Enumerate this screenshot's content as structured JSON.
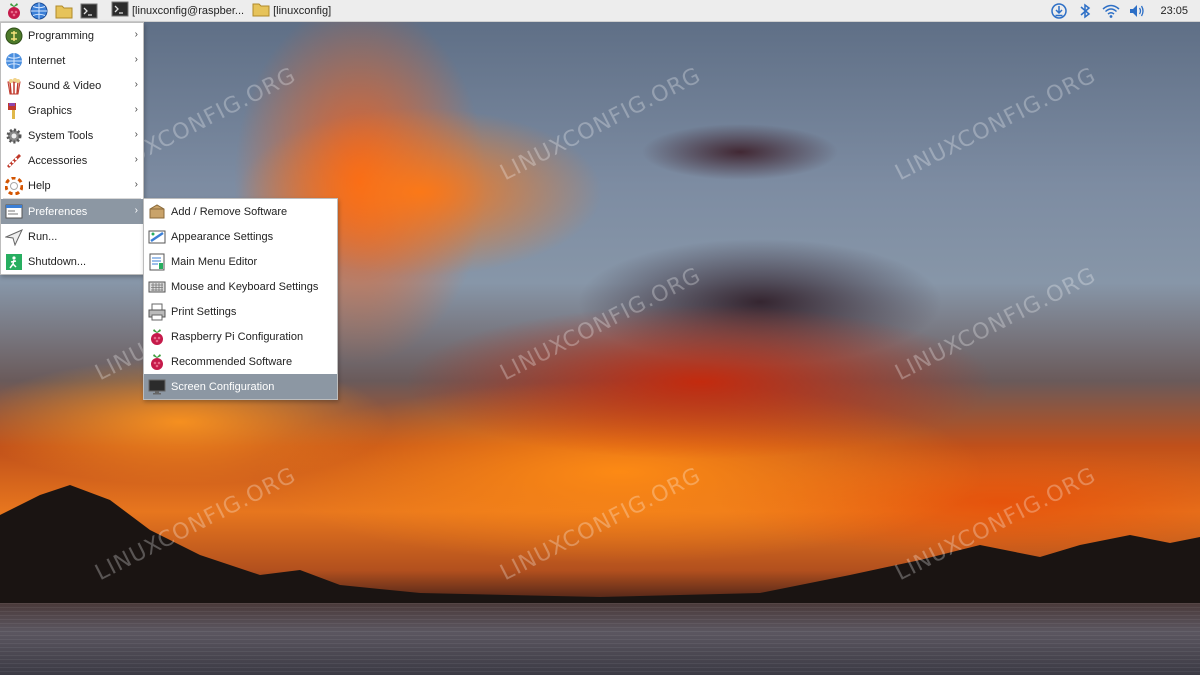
{
  "taskbar": {
    "launchers": [
      {
        "icon": "raspberry-menu-icon"
      },
      {
        "icon": "web-browser-icon"
      },
      {
        "icon": "file-manager-icon"
      },
      {
        "icon": "terminal-icon"
      }
    ],
    "windows": [
      {
        "icon": "terminal-icon",
        "label": "[linuxconfig@raspber..."
      },
      {
        "icon": "folder-icon",
        "label": "[linuxconfig]"
      }
    ],
    "tray": [
      {
        "icon": "download-updates-icon"
      },
      {
        "icon": "bluetooth-icon"
      },
      {
        "icon": "wifi-icon"
      },
      {
        "icon": "volume-icon"
      }
    ],
    "clock": "23:05"
  },
  "main_menu": {
    "items": [
      {
        "label": "Programming",
        "icon": "programming-icon",
        "has_submenu": true
      },
      {
        "label": "Internet",
        "icon": "internet-icon",
        "has_submenu": true
      },
      {
        "label": "Sound & Video",
        "icon": "sound-video-icon",
        "has_submenu": true
      },
      {
        "label": "Graphics",
        "icon": "graphics-icon",
        "has_submenu": true
      },
      {
        "label": "System Tools",
        "icon": "system-tools-icon",
        "has_submenu": true
      },
      {
        "label": "Accessories",
        "icon": "accessories-icon",
        "has_submenu": true
      },
      {
        "label": "Help",
        "icon": "help-icon",
        "has_submenu": true
      },
      {
        "label": "Preferences",
        "icon": "preferences-icon",
        "has_submenu": true,
        "active": true
      },
      {
        "label": "Run...",
        "icon": "run-icon",
        "has_submenu": false
      },
      {
        "label": "Shutdown...",
        "icon": "shutdown-icon",
        "has_submenu": false
      }
    ]
  },
  "preferences_menu": {
    "items": [
      {
        "label": "Add / Remove Software",
        "icon": "package-icon"
      },
      {
        "label": "Appearance Settings",
        "icon": "appearance-icon"
      },
      {
        "label": "Main Menu Editor",
        "icon": "menu-editor-icon"
      },
      {
        "label": "Mouse and Keyboard Settings",
        "icon": "keyboard-icon"
      },
      {
        "label": "Print Settings",
        "icon": "printer-icon"
      },
      {
        "label": "Raspberry Pi Configuration",
        "icon": "raspberry-icon"
      },
      {
        "label": "Recommended Software",
        "icon": "raspberry-icon"
      },
      {
        "label": "Screen Configuration",
        "icon": "monitor-icon",
        "active": true
      }
    ]
  },
  "desktop": {
    "watermark": "LINUXCONFIG.ORG"
  },
  "colors": {
    "menu_highlight": "#8c97a3",
    "taskbar_bg": "#ededed"
  }
}
